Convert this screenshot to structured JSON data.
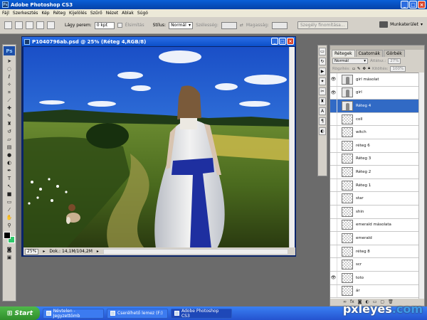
{
  "window": {
    "title": "Adobe Photoshop CS3"
  },
  "menu": [
    "Fájl",
    "Szerkesztés",
    "Kép",
    "Réteg",
    "Kijelölés",
    "Szűrő",
    "Nézet",
    "Ablak",
    "Súgó"
  ],
  "options": {
    "feather_label": "Lágy perem:",
    "feather_value": "0 kpt",
    "antialias_label": "Élsimítás",
    "style_label": "Stílus:",
    "style_value": "Normál",
    "width_label": "Szélesség:",
    "height_label": "Magasság:",
    "refine_label": "Szegély finomítása...",
    "workspace_label": "Munkaterület"
  },
  "document": {
    "title": "P1040796ab.psd @ 25% (Réteg 4,RGB/8)",
    "zoom": "25%",
    "doc_info": "Dok.: 14,1M/104,2M"
  },
  "layers_panel": {
    "tabs": [
      "Rétegek",
      "Csatornák",
      "Görbék"
    ],
    "blend_mode": "Normál",
    "opacity_label": "Átlátsz.:",
    "opacity_value": "27%",
    "lock_label": "Rögzítés:",
    "fill_label": "Kitöltés:",
    "fill_value": "100%",
    "layers": [
      {
        "name": "girl másolat",
        "visible": true,
        "selected": false,
        "thumb": "girl"
      },
      {
        "name": "girl",
        "visible": true,
        "selected": false,
        "thumb": "girl"
      },
      {
        "name": "Réteg 4",
        "visible": false,
        "selected": true,
        "thumb": "girl"
      },
      {
        "name": "coll",
        "visible": false,
        "selected": false,
        "thumb": "empty"
      },
      {
        "name": "witch",
        "visible": false,
        "selected": false,
        "thumb": "empty"
      },
      {
        "name": "réteg 6",
        "visible": false,
        "selected": false,
        "thumb": "empty"
      },
      {
        "name": "Réteg 3",
        "visible": false,
        "selected": false,
        "thumb": "empty"
      },
      {
        "name": "Réteg 2",
        "visible": false,
        "selected": false,
        "thumb": "empty"
      },
      {
        "name": "Réteg 1",
        "visible": false,
        "selected": false,
        "thumb": "empty"
      },
      {
        "name": "star",
        "visible": false,
        "selected": false,
        "thumb": "empty"
      },
      {
        "name": "shin",
        "visible": false,
        "selected": false,
        "thumb": "empty"
      },
      {
        "name": "emerald másolata",
        "visible": false,
        "selected": false,
        "thumb": "empty"
      },
      {
        "name": "emerald",
        "visible": false,
        "selected": false,
        "thumb": "empty"
      },
      {
        "name": "réteg 8",
        "visible": false,
        "selected": false,
        "thumb": "empty"
      },
      {
        "name": "scr",
        "visible": false,
        "selected": false,
        "thumb": "empty"
      },
      {
        "name": "toto",
        "visible": true,
        "selected": false,
        "thumb": "empty"
      },
      {
        "name": "ár",
        "visible": false,
        "selected": false,
        "thumb": "empty"
      }
    ]
  },
  "taskbar": {
    "start": "Start",
    "tasks": [
      "Névtelen - Jegyzettömb",
      "Cserélhető lemez (F:)",
      "Adobe Photoshop CS3"
    ]
  },
  "watermark": {
    "brand": "pxleyes",
    "tld": ".com"
  }
}
